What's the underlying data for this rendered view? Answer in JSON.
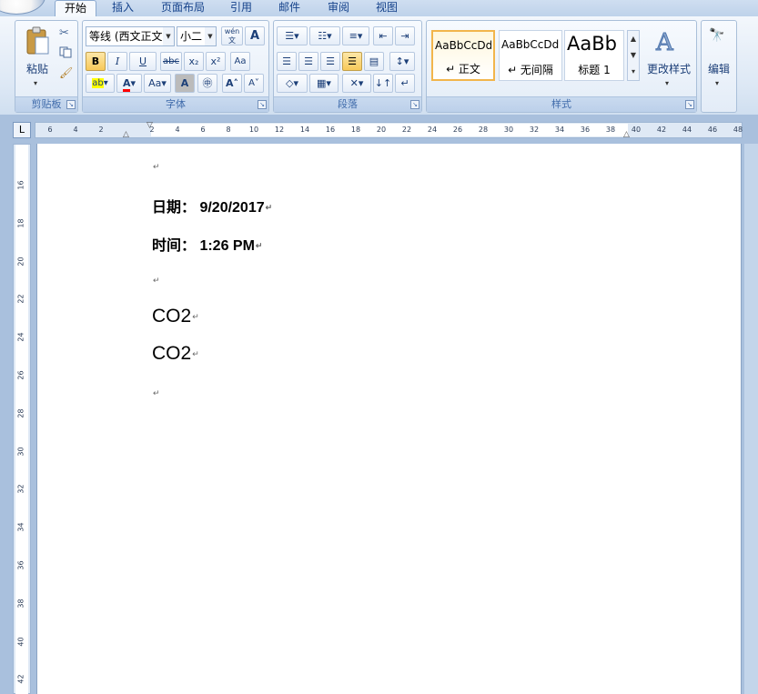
{
  "tabs": [
    "开始",
    "插入",
    "页面布局",
    "引用",
    "邮件",
    "审阅",
    "视图"
  ],
  "clipboard": {
    "paste": "粘贴",
    "group": "剪贴板"
  },
  "font": {
    "name": "等线 (西文正文",
    "size": "小二",
    "group": "字体",
    "bold": "B",
    "italic": "I",
    "underline": "U",
    "strike": "abc",
    "sub": "x₂",
    "sup": "x²",
    "grow": "A",
    "shrink": "A",
    "case": "Aa",
    "wen": "wén"
  },
  "paragraph": {
    "group": "段落"
  },
  "styles": {
    "group": "样式",
    "items": [
      {
        "preview": "AaBbCcDd",
        "name": "↵ 正文"
      },
      {
        "preview": "AaBbCcDd",
        "name": "↵ 无间隔"
      },
      {
        "preview": "AaBb",
        "name": "标题 1"
      }
    ],
    "change": "更改样式"
  },
  "editing": {
    "label": "编辑"
  },
  "ruler": {
    "h_ticks": [
      "6",
      "4",
      "2",
      "2",
      "4",
      "6",
      "8",
      "10",
      "12",
      "14",
      "16",
      "18",
      "20",
      "22",
      "24",
      "26",
      "28",
      "30",
      "32",
      "34",
      "36",
      "38",
      "40",
      "42",
      "44",
      "46",
      "48"
    ],
    "v_ticks": [
      "16",
      "18",
      "20",
      "22",
      "24",
      "26",
      "28",
      "30",
      "32",
      "34",
      "36",
      "38",
      "40",
      "42"
    ],
    "tab_selector": "L"
  },
  "document": {
    "paragraphs": [
      {
        "text": "",
        "style": "plain"
      },
      {
        "text": "日期： 9/20/2017",
        "style": "bold"
      },
      {
        "text": "时间： 1:26 PM",
        "style": "bold"
      },
      {
        "text": "",
        "style": "plain"
      },
      {
        "text": "CO2",
        "style": "co2"
      },
      {
        "text": "CO2",
        "style": "co2"
      },
      {
        "text": "",
        "style": "plain"
      }
    ],
    "para_mark": "↵"
  }
}
